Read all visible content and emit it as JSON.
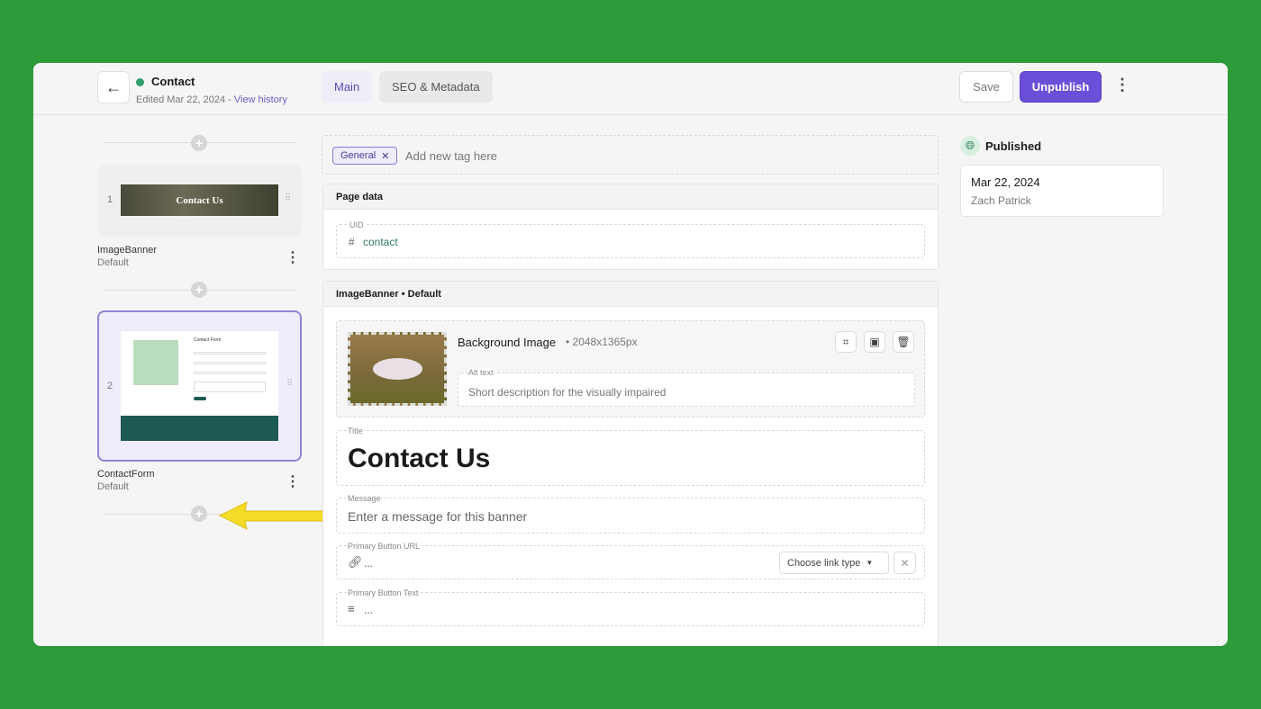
{
  "header": {
    "title": "Contact",
    "edited": "Edited Mar 22, 2024",
    "separator": " - ",
    "history_link": "View history",
    "tabs": [
      {
        "label": "Main",
        "active": true
      },
      {
        "label": "SEO & Metadata",
        "active": false
      }
    ],
    "save": "Save",
    "unpublish": "Unpublish",
    "status_color": "#2f9e6e",
    "accent": "#6b4fd8"
  },
  "slices": [
    {
      "index": "1",
      "name": "ImageBanner",
      "variation": "Default",
      "thumb_text": "Contact Us"
    },
    {
      "index": "2",
      "name": "ContactForm",
      "variation": "Default",
      "thumb_text": "Contact Form"
    }
  ],
  "tags": {
    "items": [
      "General"
    ],
    "placeholder": "Add new tag here"
  },
  "page_data": {
    "heading": "Page data",
    "uid_label": "UID",
    "uid_value": "contact"
  },
  "banner": {
    "heading": "ImageBanner • Default",
    "image_label": "Background Image",
    "image_dims": "• 2048x1365px",
    "alt_label": "Alt text",
    "alt_placeholder": "Short description for the visually impaired",
    "title_label": "Title",
    "title_value": "Contact Us",
    "message_label": "Message",
    "message_placeholder": "Enter a message for this banner",
    "url_label": "Primary Button URL",
    "url_value": "...",
    "link_type": "Choose link type",
    "text_label": "Primary Button Text",
    "text_value": "..."
  },
  "status": {
    "label": "Published",
    "date": "Mar 22, 2024",
    "author": "Zach Patrick"
  }
}
